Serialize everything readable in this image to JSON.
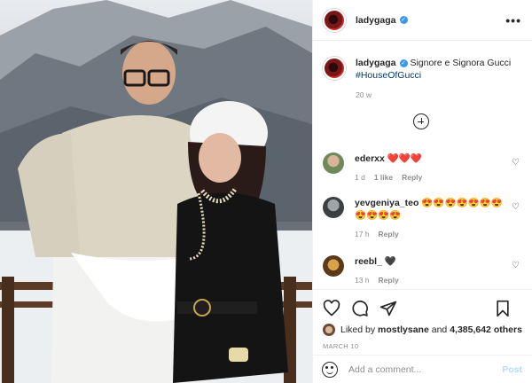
{
  "post": {
    "username": "ladygaga",
    "more_icon": "more-horizontal-icon"
  },
  "caption": {
    "username": "ladygaga",
    "text": "Signore e Signora Gucci",
    "hashtag": "#HouseOfGucci",
    "age": "20 w"
  },
  "load_more_icon": "plus-circle-icon",
  "comments": [
    {
      "username": "ederxx",
      "text": "❤️❤️❤️",
      "age": "1 d",
      "likes": "1 like",
      "reply": "Reply"
    },
    {
      "username": "yevgeniya_teo",
      "text": "😍😍😍😍😍😍😍😍😍😍😍",
      "age": "17 h",
      "likes": "",
      "reply": "Reply"
    },
    {
      "username": "reebl_",
      "text": "🖤",
      "age": "13 h",
      "likes": "",
      "reply": "Reply"
    }
  ],
  "liked_by": {
    "prefix": "Liked by",
    "user": "mostlysane",
    "and": "and",
    "count": "4,385,642 others"
  },
  "date": "MARCH 10",
  "add_comment": {
    "placeholder": "Add a comment...",
    "post_label": "Post"
  },
  "colors": {
    "link": "#00376b",
    "verified": "#3897f0",
    "post_disabled": "#b3dbff"
  }
}
